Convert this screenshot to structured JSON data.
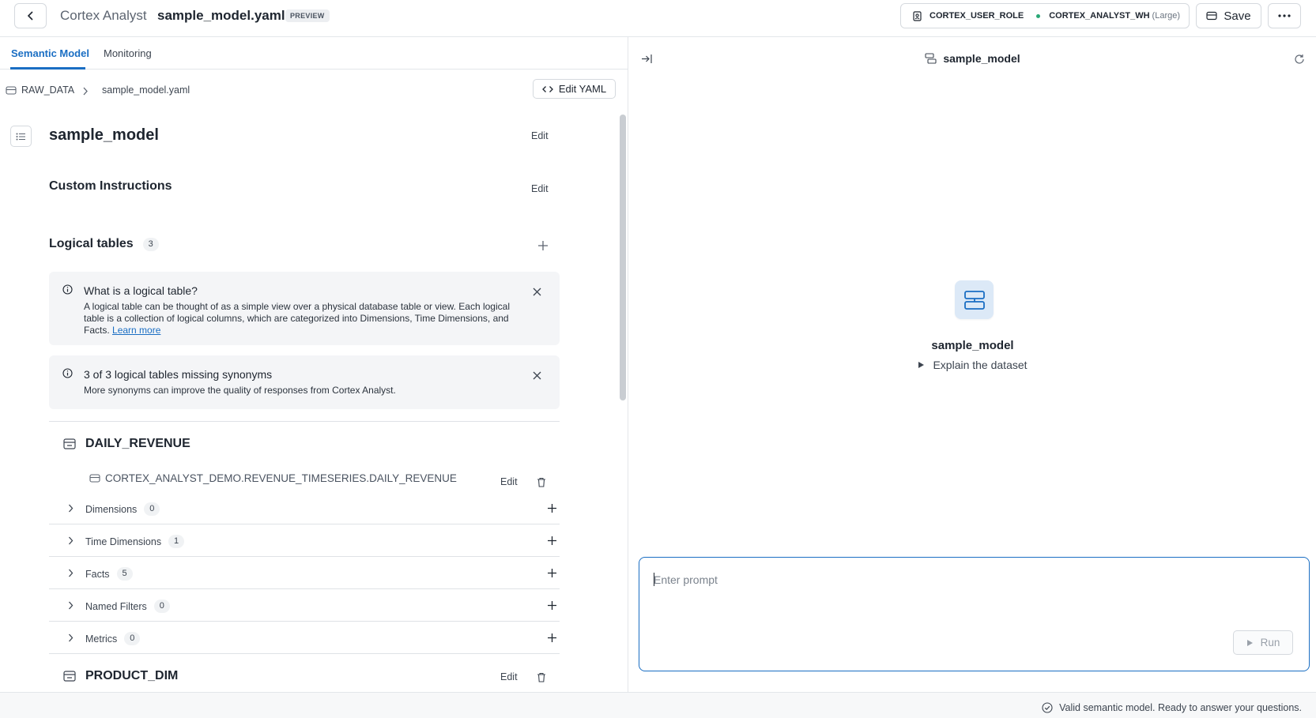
{
  "header": {
    "app_name": "Cortex Analyst",
    "file_name": "sample_model.yaml",
    "badge": "PREVIEW",
    "role": "CORTEX_USER_ROLE",
    "warehouse": "CORTEX_ANALYST_WH",
    "warehouse_size": "(Large)",
    "save_label": "Save"
  },
  "tabs": [
    {
      "label": "Semantic Model",
      "active": true
    },
    {
      "label": "Monitoring",
      "active": false
    }
  ],
  "breadcrumb": {
    "database": "RAW_DATA",
    "file": "sample_model.yaml",
    "edit_yaml_label": "Edit YAML"
  },
  "model": {
    "name": "sample_model",
    "edit_label": "Edit"
  },
  "custom_instructions": {
    "title": "Custom Instructions",
    "edit_label": "Edit"
  },
  "logical_tables": {
    "title": "Logical tables",
    "count": "3",
    "info": {
      "title": "What is a logical table?",
      "body": "A logical table can be thought of as a simple view over a physical database table or view. Each logical table is a collection of logical columns, which are categorized into Dimensions, Time Dimensions, and Facts.",
      "link": "Learn more"
    },
    "warning": {
      "title": "3 of 3 logical tables missing synonyms",
      "body": "More synonyms can improve the quality of responses from Cortex Analyst."
    },
    "tables": [
      {
        "name": "DAILY_REVENUE",
        "edit_label": "Edit",
        "path": "CORTEX_ANALYST_DEMO.REVENUE_TIMESERIES.DAILY_REVENUE",
        "groups": [
          {
            "label": "Dimensions",
            "count": "0"
          },
          {
            "label": "Time Dimensions",
            "count": "1"
          },
          {
            "label": "Facts",
            "count": "5"
          },
          {
            "label": "Named Filters",
            "count": "0"
          },
          {
            "label": "Metrics",
            "count": "0"
          }
        ]
      },
      {
        "name": "PRODUCT_DIM",
        "edit_label": "Edit"
      }
    ]
  },
  "chat": {
    "title": "sample_model",
    "center_title": "sample_model",
    "explain_label": "Explain the dataset",
    "prompt_placeholder": "Enter prompt",
    "run_label": "Run"
  },
  "status": {
    "message": "Valid semantic model. Ready to answer your questions."
  },
  "colors": {
    "accent": "#1a6ec3",
    "status_dot": "#2aa876"
  }
}
